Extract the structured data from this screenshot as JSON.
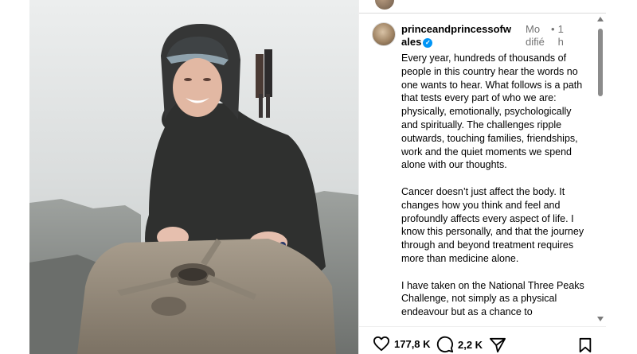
{
  "post": {
    "username": "princeandprincessofwales",
    "verified": true,
    "edited_label": "Modifié",
    "separator": "•",
    "time": "1 h",
    "caption_paragraphs": [
      "Every year, hundreds of thousands of people in this country hear the words no one wants to hear. What follows is a path that tests every part of who we are: physically, emotionally, psychologically and spiritually. The challenges ripple outwards, touching families, friendships, work and the quiet moments we spend alone with our thoughts.",
      "Cancer doesn’t just affect the body. It changes how you think and feel and profoundly affects every aspect of life. I know this personally, and that the journey through and beyond treatment requires more than medicine alone.",
      "I have taken on the National Three Peaks Challenge, not simply as a physical endeavour but as a chance to"
    ]
  },
  "actions": {
    "likes_count": "177,8 K",
    "comments_count": "2,2 K"
  },
  "icons": {
    "like": "heart-icon",
    "comment": "comment-bubble-icon",
    "share": "send-icon",
    "save": "bookmark-icon",
    "verified": "verified-badge-icon"
  },
  "colors": {
    "verified_blue": "#0095f6",
    "meta_gray": "#737373"
  }
}
